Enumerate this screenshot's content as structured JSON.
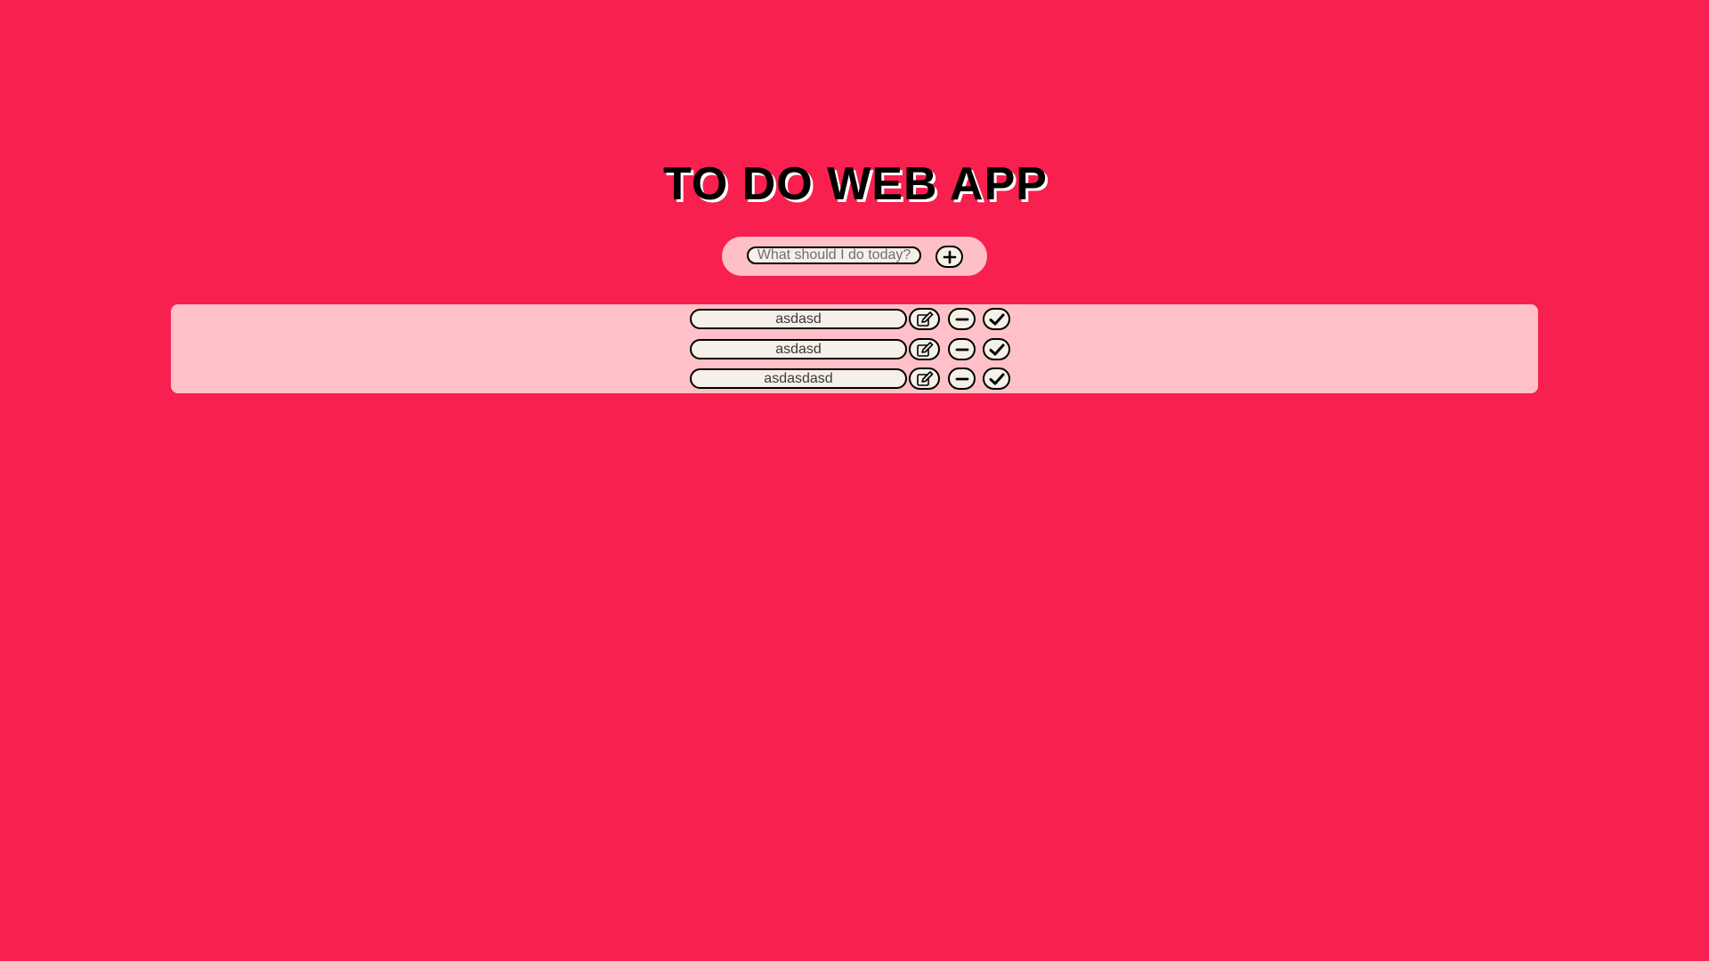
{
  "app": {
    "title": "TO DO WEB APP"
  },
  "add_bar": {
    "placeholder": "What should I do today?",
    "add_icon": "plus-circle-icon"
  },
  "todos": [
    {
      "text": "asdasd",
      "edit_icon": "edit-icon",
      "remove_icon": "minus-icon",
      "done_icon": "check-icon"
    },
    {
      "text": "asdasd",
      "edit_icon": "edit-icon",
      "remove_icon": "minus-icon",
      "done_icon": "check-icon"
    },
    {
      "text": "asdasdasd",
      "edit_icon": "edit-icon",
      "remove_icon": "minus-icon",
      "done_icon": "check-icon"
    }
  ],
  "colors": {
    "background": "#f7204f",
    "panel": "#ffc1c7",
    "add_bar": "#ffbfc6",
    "field": "#f5f0e8",
    "border": "#000000"
  }
}
